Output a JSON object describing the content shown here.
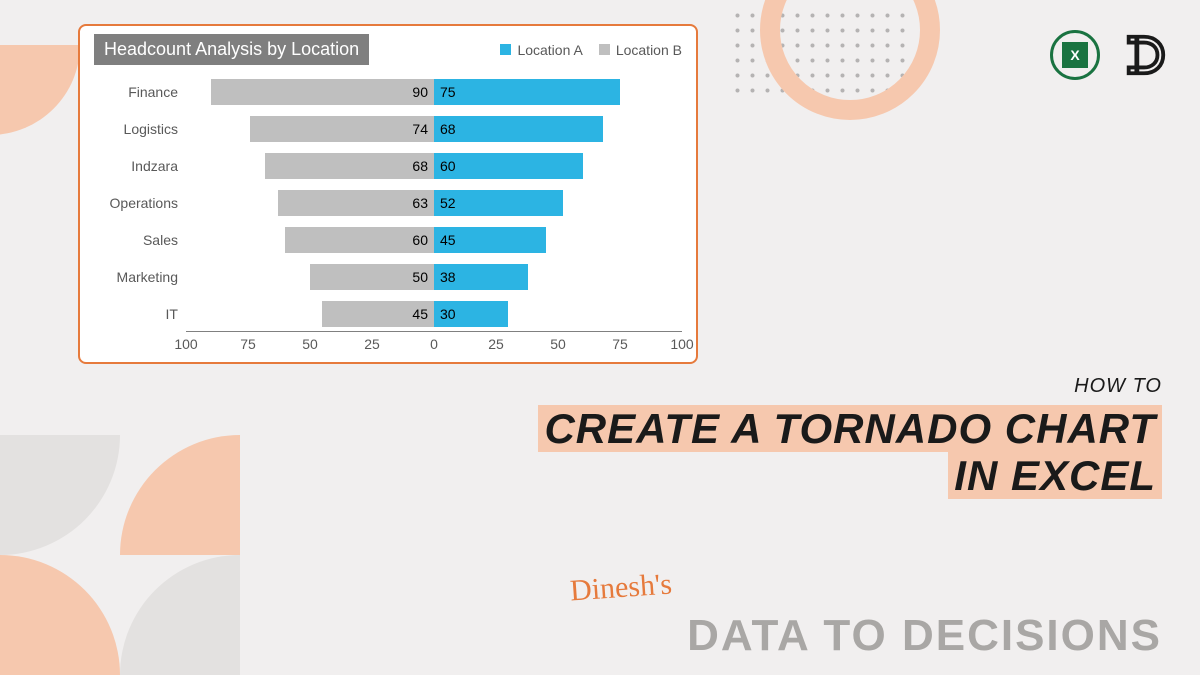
{
  "chart_data": {
    "type": "bar",
    "title": "Headcount Analysis by Location",
    "orientation": "horizontal-diverging",
    "categories": [
      "Finance",
      "Logistics",
      "Indzara",
      "Operations",
      "Sales",
      "Marketing",
      "IT"
    ],
    "series": [
      {
        "name": "Location A",
        "color": "#2cb4e3",
        "values": [
          75,
          68,
          60,
          52,
          45,
          38,
          30
        ]
      },
      {
        "name": "Location B",
        "color": "#bfbfbf",
        "values": [
          90,
          74,
          68,
          63,
          60,
          50,
          45
        ]
      }
    ],
    "x_ticks": [
      100,
      75,
      50,
      25,
      0,
      25,
      50,
      75,
      100
    ],
    "x_range_side": 100,
    "xlabel": "",
    "ylabel": ""
  },
  "legend": {
    "a": "Location A",
    "b": "Location B"
  },
  "text": {
    "overline": "HOW TO",
    "title_line1": "CREATE A TORNADO CHART",
    "title_line2": "IN EXCEL",
    "signature": "Dinesh's",
    "footer": "DATA TO DECISIONS"
  },
  "icons": {
    "excel_glyph": "X",
    "dd_glyph": "D"
  }
}
